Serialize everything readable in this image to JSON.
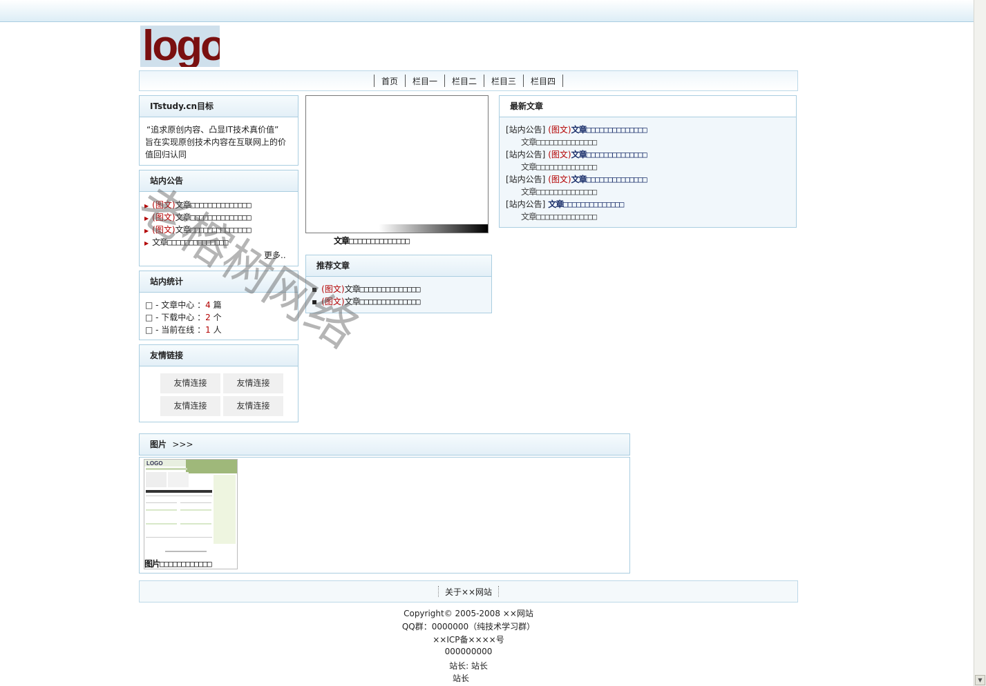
{
  "logo_text": "logo",
  "nav": [
    "首页",
    "栏目一",
    "栏目二",
    "栏目三",
    "栏目四"
  ],
  "goal_box": {
    "title": "ITstudy.cn目标",
    "lines": [
      "“追求原创内容、凸显IT技术真价值”",
      "旨在实现原创技术内容在互联网上的价",
      "值回归认同"
    ]
  },
  "notice_box": {
    "title": "站内公告",
    "items": [
      {
        "tag": "(图文)",
        "text": "文章□□□□□□□□□□□□□□"
      },
      {
        "tag": "(图文)",
        "text": "文章□□□□□□□□□□□□□□"
      },
      {
        "tag": "(图文)",
        "text": "文章□□□□□□□□□□□□□□"
      },
      {
        "tag": "",
        "text": "文章□□□□□□□□□□□□□□"
      }
    ],
    "more": "更多.."
  },
  "stats_box": {
    "title": "站内统计",
    "rows": [
      {
        "label": "□ - 文章中心 ：",
        "value": "4",
        "unit": "篇"
      },
      {
        "label": "□ - 下载中心 ：",
        "value": "2",
        "unit": "个"
      },
      {
        "label": "□ - 当前在线 ：",
        "value": "1",
        "unit": "人"
      }
    ]
  },
  "links_box": {
    "title": "友情链接",
    "links": [
      "友情连接",
      "友情连接",
      "友情连接",
      "友情连接"
    ]
  },
  "slide_caption": "文章□□□□□□□□□□□□□□",
  "recommend_box": {
    "title": "推荐文章",
    "items": [
      {
        "tag": "(图文)",
        "text": "文章□□□□□□□□□□□□□□"
      },
      {
        "tag": "(图文)",
        "text": "文章□□□□□□□□□□□□□□"
      }
    ]
  },
  "latest_box": {
    "title": "最新文章",
    "items": [
      {
        "cat": "[站内公告]",
        "tag": "(图文)",
        "title": "文章□□□□□□□□□□□□□□",
        "sub": "文章□□□□□□□□□□□□□□"
      },
      {
        "cat": "[站内公告]",
        "tag": "(图文)",
        "title": "文章□□□□□□□□□□□□□□",
        "sub": "文章□□□□□□□□□□□□□□"
      },
      {
        "cat": "[站内公告]",
        "tag": "(图文)",
        "title": "文章□□□□□□□□□□□□□□",
        "sub": "文章□□□□□□□□□□□□□□"
      },
      {
        "cat": "[站内公告]",
        "tag": "",
        "title": "文章□□□□□□□□□□□□□□",
        "sub": "文章□□□□□□□□□□□□□□"
      }
    ]
  },
  "pictures_box": {
    "title": "图片",
    "arrow": ">>>",
    "thumb_caption": "图片□□□□□□□□□□□□",
    "thumb_logo": "LOGO"
  },
  "footer": {
    "about": "关于××网站",
    "lines": [
      "Copyright© 2005-2008 ××网站",
      "QQ群：0000000（纯技术学习群）",
      "××ICP备××××号",
      "000000000",
      "站长: 站长",
      "站长"
    ]
  },
  "watermark": "老榕树网络"
}
